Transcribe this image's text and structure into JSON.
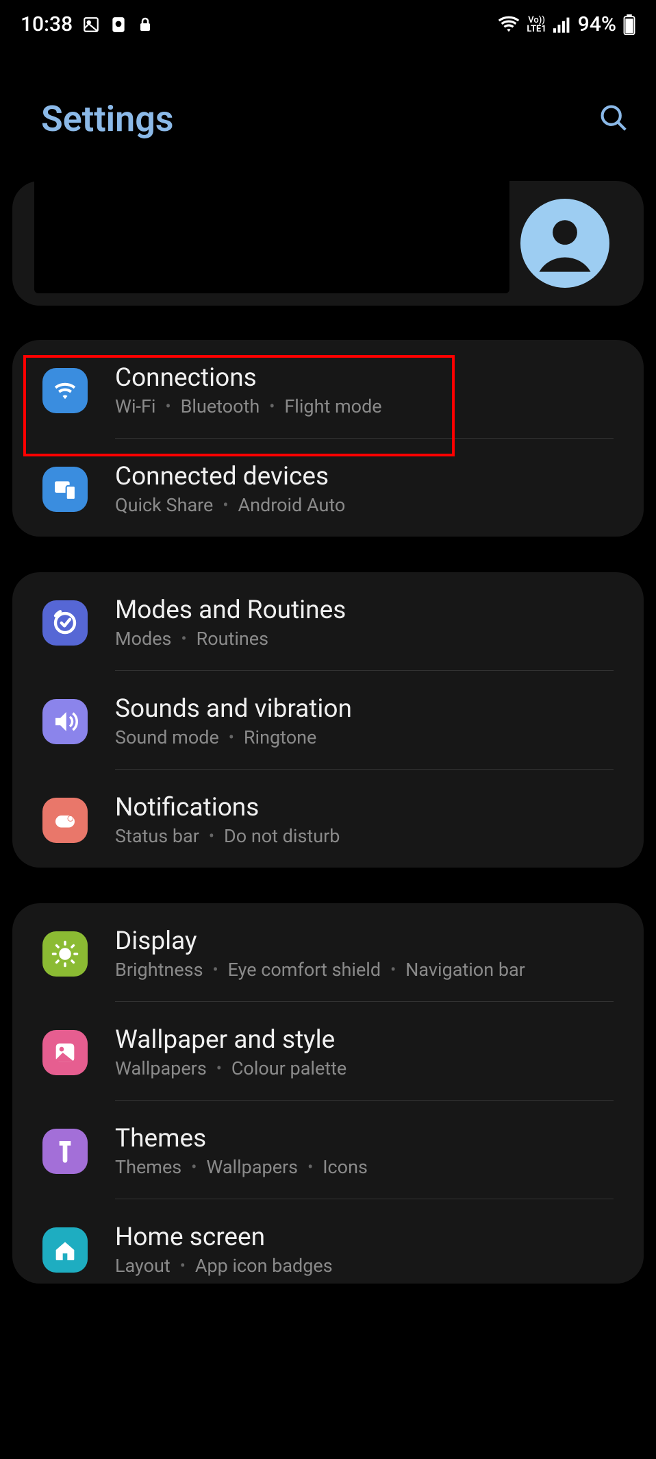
{
  "status": {
    "time": "10:38",
    "battery": "94%",
    "network_label": "LTE1",
    "vo_label": "Vo))"
  },
  "header": {
    "title": "Settings"
  },
  "highlight": {
    "target": "connections"
  },
  "groups": [
    {
      "items": [
        {
          "id": "connections",
          "title": "Connections",
          "subtitle_parts": [
            "Wi-Fi",
            "Bluetooth",
            "Flight mode"
          ],
          "icon": "wifi",
          "color": "#3a8ddf"
        },
        {
          "id": "connected-devices",
          "title": "Connected devices",
          "subtitle_parts": [
            "Quick Share",
            "Android Auto"
          ],
          "icon": "devices",
          "color": "#3a8ddf"
        }
      ]
    },
    {
      "items": [
        {
          "id": "modes-routines",
          "title": "Modes and Routines",
          "subtitle_parts": [
            "Modes",
            "Routines"
          ],
          "icon": "routines",
          "color": "#5667d5"
        },
        {
          "id": "sounds-vibration",
          "title": "Sounds and vibration",
          "subtitle_parts": [
            "Sound mode",
            "Ringtone"
          ],
          "icon": "sound",
          "color": "#8b84eb"
        },
        {
          "id": "notifications",
          "title": "Notifications",
          "subtitle_parts": [
            "Status bar",
            "Do not disturb"
          ],
          "icon": "notifications",
          "color": "#e9776a"
        }
      ]
    },
    {
      "items": [
        {
          "id": "display",
          "title": "Display",
          "subtitle_parts": [
            "Brightness",
            "Eye comfort shield",
            "Navigation bar"
          ],
          "icon": "display",
          "color": "#8bbb33"
        },
        {
          "id": "wallpaper-style",
          "title": "Wallpaper and style",
          "subtitle_parts": [
            "Wallpapers",
            "Colour palette"
          ],
          "icon": "wallpaper",
          "color": "#e65e90"
        },
        {
          "id": "themes",
          "title": "Themes",
          "subtitle_parts": [
            "Themes",
            "Wallpapers",
            "Icons"
          ],
          "icon": "themes",
          "color": "#a36fd8"
        },
        {
          "id": "home-screen",
          "title": "Home screen",
          "subtitle_parts": [
            "Layout",
            "App icon badges"
          ],
          "icon": "home",
          "color": "#1eadc1"
        }
      ]
    }
  ]
}
